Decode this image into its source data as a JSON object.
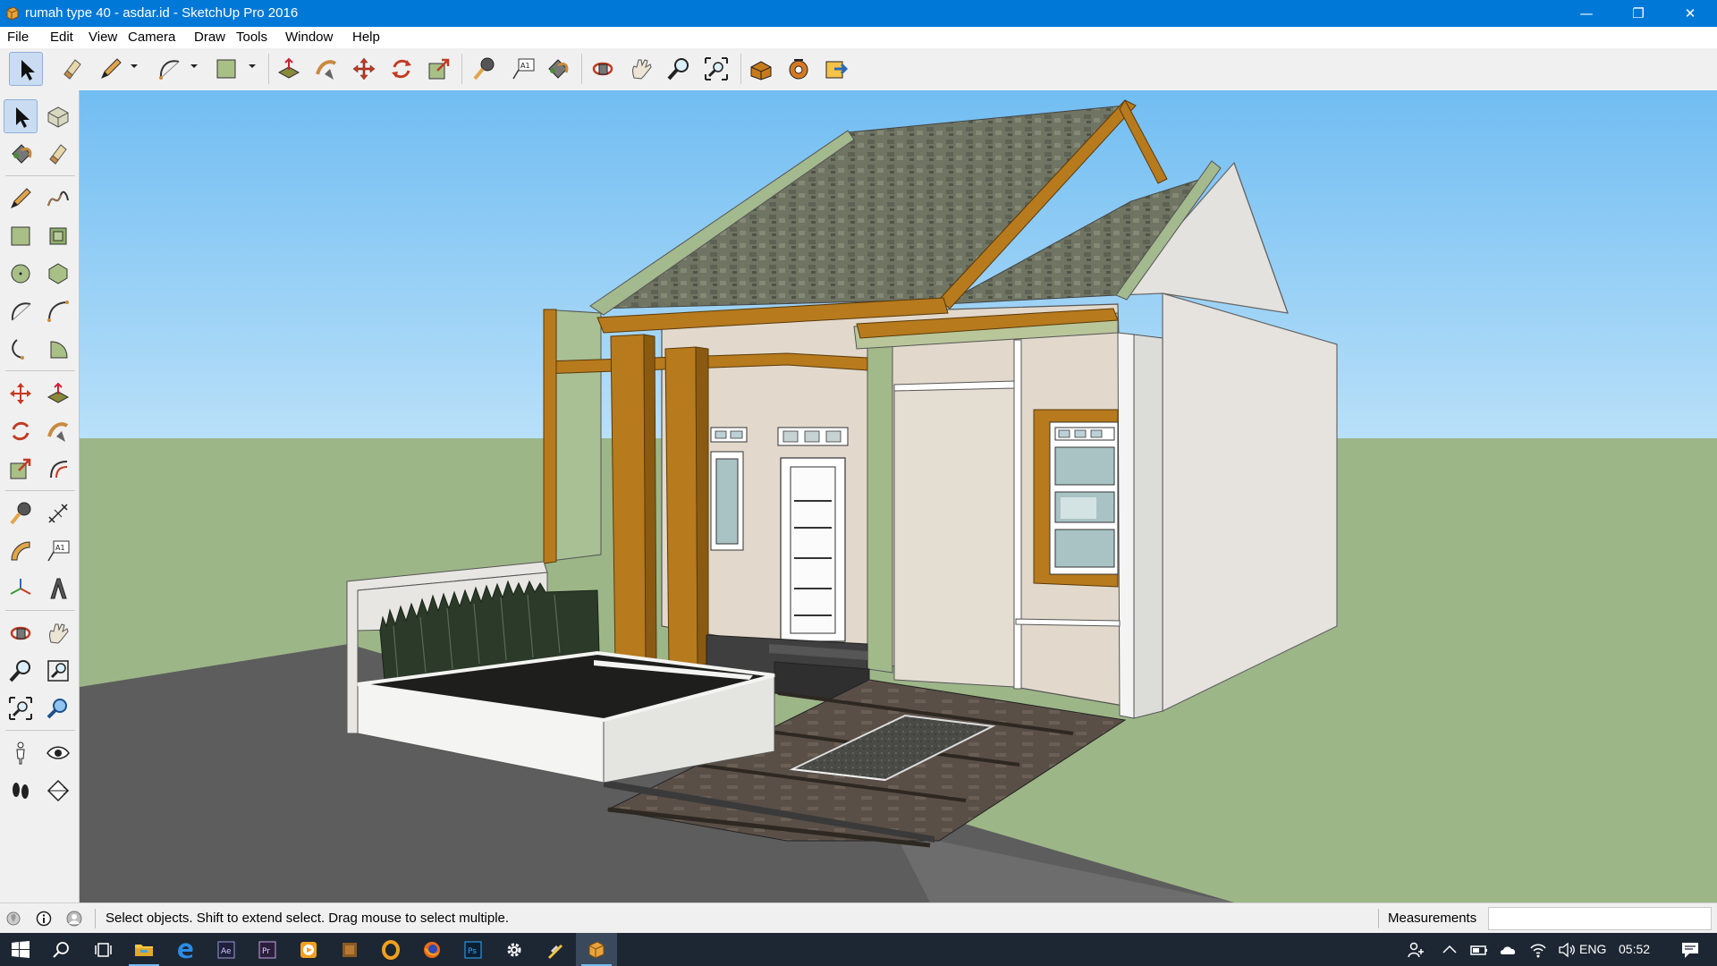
{
  "window": {
    "title": "rumah type 40 - asdar.id - SketchUp Pro 2016",
    "controls": {
      "minimize": "—",
      "restore": "❐",
      "close": "✕"
    }
  },
  "menu": [
    "File",
    "Edit",
    "View",
    "Camera",
    "Draw",
    "Tools",
    "Window",
    "Help"
  ],
  "status": {
    "hint": "Select objects. Shift to extend select. Drag mouse to select multiple.",
    "measurements_label": "Measurements",
    "measurements_value": ""
  },
  "taskbar": {
    "language": "ENG",
    "time": "05:52"
  },
  "colors": {
    "titlebar": "#0078d7",
    "sky": "#7cc2f2",
    "ground": "#9db688",
    "road": "#5d5d5d",
    "accent_wood": "#b77a1d"
  }
}
